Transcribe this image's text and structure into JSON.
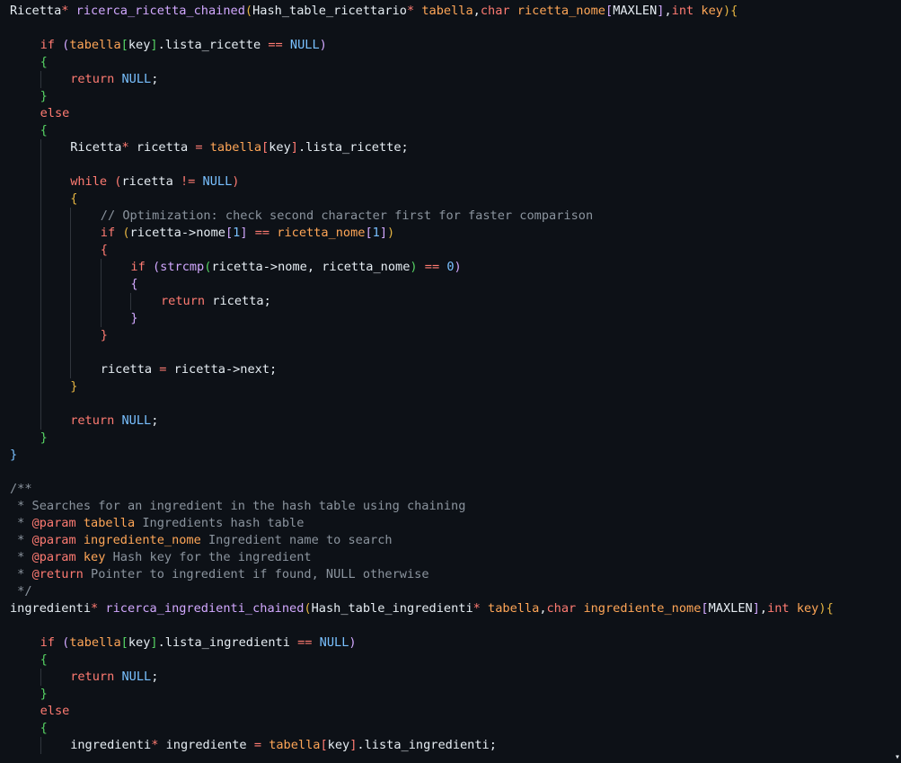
{
  "editor": {
    "language": "c",
    "theme_colors": {
      "background": "#0d1117",
      "keyword": "#ff7b72",
      "function": "#d2a8ff",
      "parameter": "#ffa657",
      "constant": "#79c0ff",
      "comment": "#8b949e",
      "plain": "#e6edf3"
    },
    "lines": [
      {
        "indent": 0,
        "tokens": [
          [
            "Ricetta",
            "plain"
          ],
          [
            "*",
            "op"
          ],
          [
            " ",
            "plain"
          ],
          [
            "ricerca_ricetta_chained",
            "fn"
          ],
          [
            "(",
            "b1"
          ],
          [
            "Hash_table_ricettario",
            "plain"
          ],
          [
            "*",
            "op"
          ],
          [
            " ",
            "plain"
          ],
          [
            "tabella",
            "param"
          ],
          [
            ",",
            "plain"
          ],
          [
            "char",
            "kw"
          ],
          [
            " ",
            "plain"
          ],
          [
            "ricetta_nome",
            "param"
          ],
          [
            "[",
            "b2"
          ],
          [
            "MAXLEN",
            "plain"
          ],
          [
            "]",
            "b2"
          ],
          [
            ",",
            "plain"
          ],
          [
            "int",
            "kw"
          ],
          [
            " ",
            "plain"
          ],
          [
            "key",
            "param"
          ],
          [
            ")",
            "b1"
          ],
          [
            "{",
            "b1"
          ]
        ]
      },
      {
        "indent": 0,
        "tokens": []
      },
      {
        "indent": 1,
        "tokens": [
          [
            "if",
            "kw"
          ],
          [
            " ",
            "plain"
          ],
          [
            "(",
            "b2"
          ],
          [
            "tabella",
            "param"
          ],
          [
            "[",
            "b3"
          ],
          [
            "key",
            "plain"
          ],
          [
            "]",
            "b3"
          ],
          [
            ".lista_ricette ",
            "plain"
          ],
          [
            "==",
            "op"
          ],
          [
            " ",
            "plain"
          ],
          [
            "NULL",
            "const"
          ],
          [
            ")",
            "b2"
          ]
        ]
      },
      {
        "indent": 1,
        "tokens": [
          [
            "{",
            "b3"
          ]
        ]
      },
      {
        "indent": 2,
        "tokens": [
          [
            "return",
            "kw"
          ],
          [
            " ",
            "plain"
          ],
          [
            "NULL",
            "const"
          ],
          [
            ";",
            "plain"
          ]
        ]
      },
      {
        "indent": 1,
        "tokens": [
          [
            "}",
            "b3"
          ]
        ]
      },
      {
        "indent": 1,
        "tokens": [
          [
            "else",
            "kw"
          ]
        ]
      },
      {
        "indent": 1,
        "tokens": [
          [
            "{",
            "b3"
          ]
        ]
      },
      {
        "indent": 2,
        "tokens": [
          [
            "Ricetta",
            "plain"
          ],
          [
            "*",
            "op"
          ],
          [
            " ricetta ",
            "plain"
          ],
          [
            "=",
            "op"
          ],
          [
            " ",
            "plain"
          ],
          [
            "tabella",
            "param"
          ],
          [
            "[",
            "b4"
          ],
          [
            "key",
            "plain"
          ],
          [
            "]",
            "b4"
          ],
          [
            ".lista_ricette;",
            "plain"
          ]
        ]
      },
      {
        "indent": 0,
        "tokens": []
      },
      {
        "indent": 2,
        "tokens": [
          [
            "while",
            "kw"
          ],
          [
            " ",
            "plain"
          ],
          [
            "(",
            "b4"
          ],
          [
            "ricetta ",
            "plain"
          ],
          [
            "!=",
            "op"
          ],
          [
            " ",
            "plain"
          ],
          [
            "NULL",
            "const"
          ],
          [
            ")",
            "b4"
          ]
        ]
      },
      {
        "indent": 2,
        "tokens": [
          [
            "{",
            "b1"
          ]
        ]
      },
      {
        "indent": 3,
        "tokens": [
          [
            "// Optimization: check second character first for faster comparison",
            "comment"
          ]
        ]
      },
      {
        "indent": 3,
        "tokens": [
          [
            "if",
            "kw"
          ],
          [
            " ",
            "plain"
          ],
          [
            "(",
            "b1"
          ],
          [
            "ricetta->nome",
            "plain"
          ],
          [
            "[",
            "b2"
          ],
          [
            "1",
            "const"
          ],
          [
            "]",
            "b2"
          ],
          [
            " ",
            "plain"
          ],
          [
            "==",
            "op"
          ],
          [
            " ",
            "plain"
          ],
          [
            "ricetta_nome",
            "param"
          ],
          [
            "[",
            "b2"
          ],
          [
            "1",
            "const"
          ],
          [
            "]",
            "b2"
          ],
          [
            ")",
            "b1"
          ]
        ]
      },
      {
        "indent": 3,
        "tokens": [
          [
            "{",
            "b4"
          ]
        ]
      },
      {
        "indent": 4,
        "tokens": [
          [
            "if",
            "kw"
          ],
          [
            " ",
            "plain"
          ],
          [
            "(",
            "b2"
          ],
          [
            "strcmp",
            "fn"
          ],
          [
            "(",
            "b3"
          ],
          [
            "ricetta->nome, ricetta_nome",
            "plain"
          ],
          [
            ")",
            "b3"
          ],
          [
            " ",
            "plain"
          ],
          [
            "==",
            "op"
          ],
          [
            " ",
            "plain"
          ],
          [
            "0",
            "const"
          ],
          [
            ")",
            "b2"
          ]
        ]
      },
      {
        "indent": 4,
        "tokens": [
          [
            "{",
            "b2"
          ]
        ]
      },
      {
        "indent": 5,
        "tokens": [
          [
            "return",
            "kw"
          ],
          [
            " ricetta;",
            "plain"
          ]
        ]
      },
      {
        "indent": 4,
        "tokens": [
          [
            "}",
            "b2"
          ]
        ]
      },
      {
        "indent": 3,
        "tokens": [
          [
            "}",
            "b4"
          ]
        ]
      },
      {
        "indent": 0,
        "tokens": []
      },
      {
        "indent": 3,
        "tokens": [
          [
            "ricetta ",
            "plain"
          ],
          [
            "=",
            "op"
          ],
          [
            " ricetta->next;",
            "plain"
          ]
        ]
      },
      {
        "indent": 2,
        "tokens": [
          [
            "}",
            "b1"
          ]
        ]
      },
      {
        "indent": 0,
        "tokens": []
      },
      {
        "indent": 2,
        "tokens": [
          [
            "return",
            "kw"
          ],
          [
            " ",
            "plain"
          ],
          [
            "NULL",
            "const"
          ],
          [
            ";",
            "plain"
          ]
        ]
      },
      {
        "indent": 1,
        "tokens": [
          [
            "}",
            "b3"
          ]
        ]
      },
      {
        "indent": 0,
        "tokens": [
          [
            "}",
            "b5"
          ]
        ]
      },
      {
        "indent": 0,
        "tokens": []
      },
      {
        "indent": 0,
        "tokens": [
          [
            "/**",
            "comment"
          ]
        ]
      },
      {
        "indent": 0,
        "tokens": [
          [
            " * Searches for an ingredient in the hash table using chaining",
            "comment"
          ]
        ]
      },
      {
        "indent": 0,
        "tokens": [
          [
            " * ",
            "comment"
          ],
          [
            "@param",
            "kw"
          ],
          [
            " ",
            "comment"
          ],
          [
            "tabella",
            "param"
          ],
          [
            " Ingredients hash table",
            "comment"
          ]
        ]
      },
      {
        "indent": 0,
        "tokens": [
          [
            " * ",
            "comment"
          ],
          [
            "@param",
            "kw"
          ],
          [
            " ",
            "comment"
          ],
          [
            "ingrediente_nome",
            "param"
          ],
          [
            " Ingredient name to search",
            "comment"
          ]
        ]
      },
      {
        "indent": 0,
        "tokens": [
          [
            " * ",
            "comment"
          ],
          [
            "@param",
            "kw"
          ],
          [
            " ",
            "comment"
          ],
          [
            "key",
            "param"
          ],
          [
            " Hash key for the ingredient",
            "comment"
          ]
        ]
      },
      {
        "indent": 0,
        "tokens": [
          [
            " * ",
            "comment"
          ],
          [
            "@return",
            "kw"
          ],
          [
            " Pointer to ingredient if found, NULL otherwise",
            "comment"
          ]
        ]
      },
      {
        "indent": 0,
        "tokens": [
          [
            " */",
            "comment"
          ]
        ]
      },
      {
        "indent": 0,
        "tokens": [
          [
            "ingredienti",
            "plain"
          ],
          [
            "*",
            "op"
          ],
          [
            " ",
            "plain"
          ],
          [
            "ricerca_ingredienti_chained",
            "fn"
          ],
          [
            "(",
            "b1"
          ],
          [
            "Hash_table_ingredienti",
            "plain"
          ],
          [
            "*",
            "op"
          ],
          [
            " ",
            "plain"
          ],
          [
            "tabella",
            "param"
          ],
          [
            ",",
            "plain"
          ],
          [
            "char",
            "kw"
          ],
          [
            " ",
            "plain"
          ],
          [
            "ingrediente_nome",
            "param"
          ],
          [
            "[",
            "b2"
          ],
          [
            "MAXLEN",
            "plain"
          ],
          [
            "]",
            "b2"
          ],
          [
            ",",
            "plain"
          ],
          [
            "int",
            "kw"
          ],
          [
            " ",
            "plain"
          ],
          [
            "key",
            "param"
          ],
          [
            ")",
            "b1"
          ],
          [
            "{",
            "b1"
          ]
        ]
      },
      {
        "indent": 0,
        "tokens": []
      },
      {
        "indent": 1,
        "tokens": [
          [
            "if",
            "kw"
          ],
          [
            " ",
            "plain"
          ],
          [
            "(",
            "b2"
          ],
          [
            "tabella",
            "param"
          ],
          [
            "[",
            "b3"
          ],
          [
            "key",
            "plain"
          ],
          [
            "]",
            "b3"
          ],
          [
            ".lista_ingredienti ",
            "plain"
          ],
          [
            "==",
            "op"
          ],
          [
            " ",
            "plain"
          ],
          [
            "NULL",
            "const"
          ],
          [
            ")",
            "b2"
          ]
        ]
      },
      {
        "indent": 1,
        "tokens": [
          [
            "{",
            "b3"
          ]
        ]
      },
      {
        "indent": 2,
        "tokens": [
          [
            "return",
            "kw"
          ],
          [
            " ",
            "plain"
          ],
          [
            "NULL",
            "const"
          ],
          [
            ";",
            "plain"
          ]
        ]
      },
      {
        "indent": 1,
        "tokens": [
          [
            "}",
            "b3"
          ]
        ]
      },
      {
        "indent": 1,
        "tokens": [
          [
            "else",
            "kw"
          ]
        ]
      },
      {
        "indent": 1,
        "tokens": [
          [
            "{",
            "b3"
          ]
        ]
      },
      {
        "indent": 2,
        "tokens": [
          [
            "ingredienti",
            "plain"
          ],
          [
            "*",
            "op"
          ],
          [
            " ingrediente ",
            "plain"
          ],
          [
            "=",
            "op"
          ],
          [
            " ",
            "plain"
          ],
          [
            "tabella",
            "param"
          ],
          [
            "[",
            "b4"
          ],
          [
            "key",
            "plain"
          ],
          [
            "]",
            "b4"
          ],
          [
            ".lista_ingredienti;",
            "plain"
          ]
        ]
      }
    ]
  }
}
